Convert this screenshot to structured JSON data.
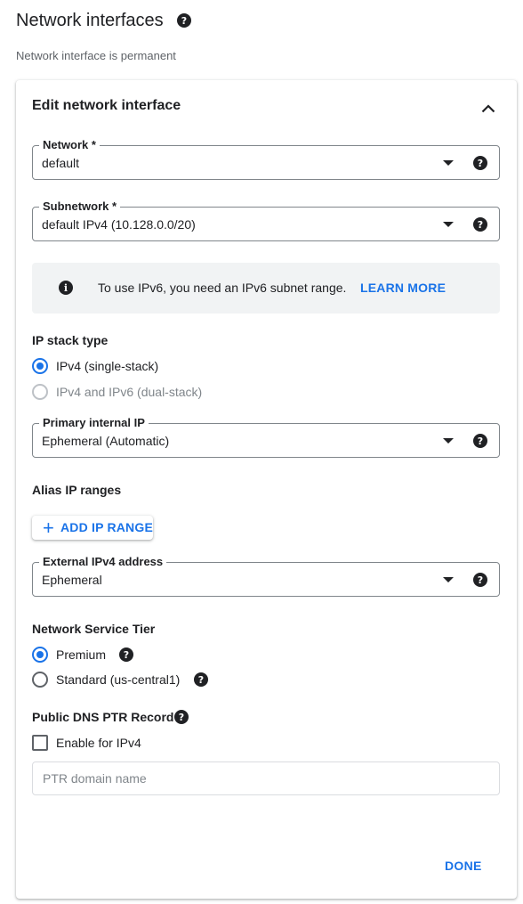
{
  "page": {
    "title": "Network interfaces",
    "subtitle": "Network interface is permanent",
    "title_help_icon": "help-icon"
  },
  "card": {
    "title": "Edit network interface",
    "collapse_icon": "chevron-up-icon"
  },
  "network": {
    "label": "Network *",
    "value": "default"
  },
  "subnetwork": {
    "label": "Subnetwork *",
    "value": "default IPv4 (10.128.0.0/20)"
  },
  "info": {
    "icon": "info-icon",
    "text": "To use IPv6, you need an IPv6 subnet range.",
    "link": "LEARN MORE"
  },
  "ip_stack": {
    "label": "IP stack type",
    "options": [
      {
        "label": "IPv4 (single-stack)",
        "checked": true,
        "disabled": false
      },
      {
        "label": "IPv4 and IPv6 (dual-stack)",
        "checked": false,
        "disabled": true
      }
    ]
  },
  "primary_ip": {
    "label": "Primary internal IP",
    "value": "Ephemeral (Automatic)"
  },
  "alias": {
    "label": "Alias IP ranges",
    "button": "ADD IP RANGE",
    "button_icon": "plus-icon"
  },
  "external_ip": {
    "label": "External IPv4 address",
    "value": "Ephemeral"
  },
  "tier": {
    "label": "Network Service Tier",
    "options": [
      {
        "label": "Premium",
        "checked": true
      },
      {
        "label": "Standard (us-central1)",
        "checked": false
      }
    ]
  },
  "dns": {
    "label": "Public DNS PTR Record",
    "checkbox_label": "Enable for IPv4",
    "checked": false,
    "input_placeholder": "PTR domain name"
  },
  "actions": {
    "done": "DONE"
  },
  "colors": {
    "accent": "#1a73e8",
    "text": "#202124",
    "muted": "#5f6368",
    "info_bg": "#f1f3f4"
  }
}
